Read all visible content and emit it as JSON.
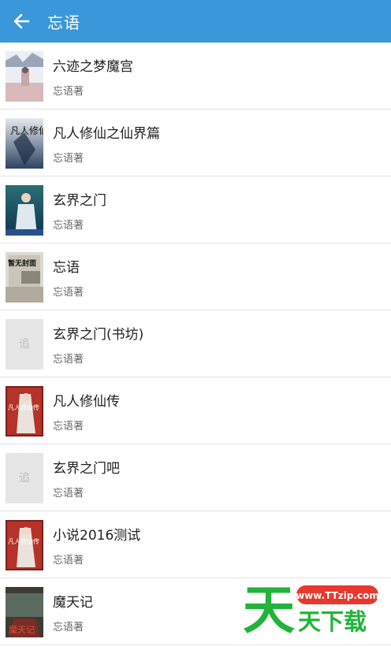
{
  "header": {
    "title": "忘语",
    "back_icon": "arrow-left-icon"
  },
  "books": [
    {
      "title": "六迹之梦魔宫",
      "author": "忘语著",
      "cover": "cover-1"
    },
    {
      "title": "凡人修仙之仙界篇",
      "author": "忘语著",
      "cover": "cover-2"
    },
    {
      "title": "玄界之门",
      "author": "忘语著",
      "cover": "cover-3"
    },
    {
      "title": "忘语",
      "author": "忘语著",
      "cover": "cover-4"
    },
    {
      "title": "玄界之门(书坊)",
      "author": "忘语著",
      "cover": "placeholder"
    },
    {
      "title": "凡人修仙传",
      "author": "忘语著",
      "cover": "cover-6"
    },
    {
      "title": "玄界之门吧",
      "author": "忘语著",
      "cover": "placeholder"
    },
    {
      "title": "小说2016测试",
      "author": "忘语著",
      "cover": "cover-6"
    },
    {
      "title": "魔天记",
      "author": "忘语著",
      "cover": "cover-9"
    }
  ],
  "cover_text": {
    "cover4": "暂无封面",
    "placeholder_logo": "追",
    "cover2": "凡人修仙",
    "cover6": "凡人修仙传",
    "cover9": "魔天记"
  },
  "watermark": {
    "url": "www.TTzip.com",
    "logo": "天",
    "text": "天下载"
  },
  "colors": {
    "appbar": "#3a97d9",
    "divider": "#e4e4e4",
    "watermark_green": "#21b33a",
    "watermark_red": "#e8372c"
  }
}
